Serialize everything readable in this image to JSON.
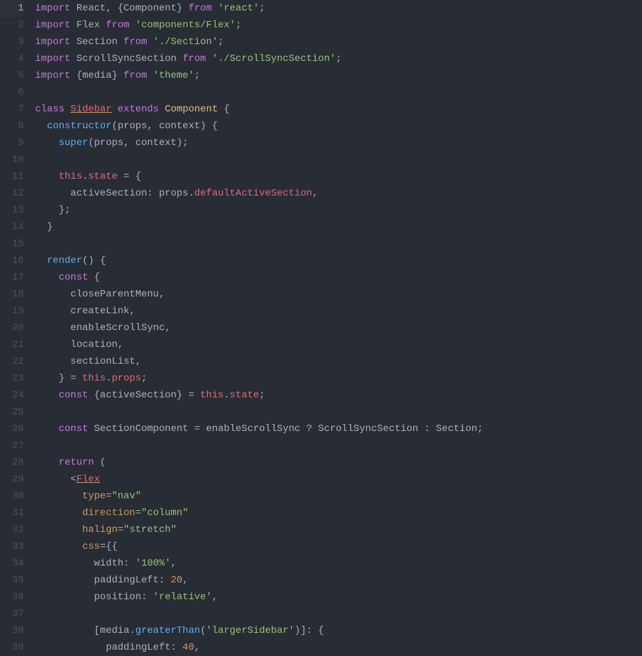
{
  "editor": {
    "active_line": 1,
    "line_count": 39,
    "lines": {
      "l1": {
        "html": "<span class='kw'>import</span><span class='def'> React, {Component} </span><span class='kw'>from</span><span class='def'> </span><span class='str'>'react'</span><span class='def'>;</span>"
      },
      "l2": {
        "html": "<span class='kw'>import</span><span class='def'> Flex </span><span class='kw'>from</span><span class='def'> </span><span class='str'>'components/Flex'</span><span class='def'>;</span>"
      },
      "l3": {
        "html": "<span class='kw'>import</span><span class='def'> Section </span><span class='kw'>from</span><span class='def'> </span><span class='str'>'./Section'</span><span class='def'>;</span>"
      },
      "l4": {
        "html": "<span class='kw'>import</span><span class='def'> ScrollSyncSection </span><span class='kw'>from</span><span class='def'> </span><span class='str'>'./ScrollSyncSection'</span><span class='def'>;</span>"
      },
      "l5": {
        "html": "<span class='kw'>import</span><span class='def'> {media} </span><span class='kw'>from</span><span class='def'> </span><span class='str'>'theme'</span><span class='def'>;</span>"
      },
      "l6": {
        "html": ""
      },
      "l7": {
        "html": "<span class='kw'>class</span><span class='def'> </span><span class='comp'>Sidebar</span><span class='def'> </span><span class='kw'>extends</span><span class='def'> </span><span class='cls'>Component</span><span class='def'> {</span>"
      },
      "l8": {
        "html": "  <span class='fn'>constructor</span><span class='def'>(props, context) {</span>"
      },
      "l9": {
        "html": "    <span class='fn'>super</span><span class='def'>(props, context);</span>"
      },
      "l10": {
        "html": ""
      },
      "l11": {
        "html": "    <span class='self'>this</span><span class='def'>.</span><span class='prop'>state</span><span class='def'> = {</span>"
      },
      "l12": {
        "html": "      <span class='def'>activeSection: props.</span><span class='prop'>defaultActiveSection</span><span class='def'>,</span>"
      },
      "l13": {
        "html": "    <span class='def'>};</span>"
      },
      "l14": {
        "html": "  <span class='def'>}</span>"
      },
      "l15": {
        "html": ""
      },
      "l16": {
        "html": "  <span class='fn'>render</span><span class='def'>() {</span>"
      },
      "l17": {
        "html": "    <span class='kw'>const</span><span class='def'> {</span>"
      },
      "l18": {
        "html": "      <span class='def'>closeParentMenu,</span>"
      },
      "l19": {
        "html": "      <span class='def'>createLink,</span>"
      },
      "l20": {
        "html": "      <span class='def'>enableScrollSync,</span>"
      },
      "l21": {
        "html": "      <span class='def'>location,</span>"
      },
      "l22": {
        "html": "      <span class='def'>sectionList,</span>"
      },
      "l23": {
        "html": "    <span class='def'>} = </span><span class='self'>this</span><span class='def'>.</span><span class='prop'>props</span><span class='def'>;</span>"
      },
      "l24": {
        "html": "    <span class='kw'>const</span><span class='def'> {activeSection} = </span><span class='self'>this</span><span class='def'>.</span><span class='prop'>state</span><span class='def'>;</span>"
      },
      "l25": {
        "html": ""
      },
      "l26": {
        "html": "    <span class='kw'>const</span><span class='def'> SectionComponent = enableScrollSync ? ScrollSyncSection : Section;</span>"
      },
      "l27": {
        "html": ""
      },
      "l28": {
        "html": "    <span class='kw'>return</span><span class='def'> (</span>"
      },
      "l29": {
        "html": "      <span class='def'>&lt;</span><span class='comp'>Flex</span>"
      },
      "l30": {
        "html": "        <span class='attr'>type</span><span class='def'>=</span><span class='str'>\"nav\"</span>"
      },
      "l31": {
        "html": "        <span class='attr'>direction</span><span class='def'>=</span><span class='str'>\"column\"</span>"
      },
      "l32": {
        "html": "        <span class='attr'>halign</span><span class='def'>=</span><span class='str'>\"stretch\"</span>"
      },
      "l33": {
        "html": "        <span class='attr'>css</span><span class='def'>={{</span>"
      },
      "l34": {
        "html": "          <span class='def'>width: </span><span class='str'>'100%'</span><span class='def'>,</span>"
      },
      "l35": {
        "html": "          <span class='def'>paddingLeft: </span><span class='num'>20</span><span class='def'>,</span>"
      },
      "l36": {
        "html": "          <span class='def'>position: </span><span class='str'>'relative'</span><span class='def'>,</span>"
      },
      "l37": {
        "html": ""
      },
      "l38": {
        "html": "          <span class='def'>[media.</span><span class='fn'>greaterThan</span><span class='def'>(</span><span class='str'>'largerSidebar'</span><span class='def'>)]: {</span>"
      },
      "l39": {
        "html": "            <span class='def'>paddingLeft: </span><span class='num'>40</span><span class='def'>,</span>"
      }
    }
  }
}
